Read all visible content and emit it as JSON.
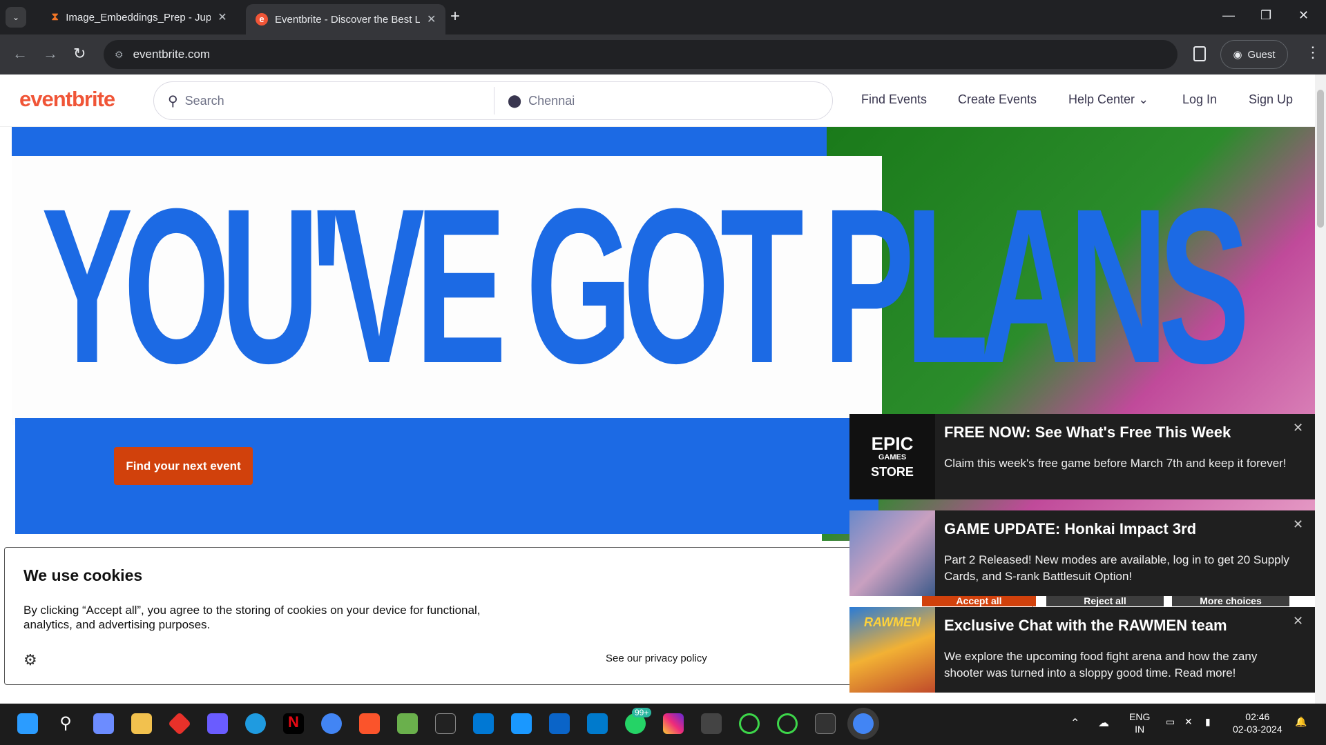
{
  "browser": {
    "tabs": [
      {
        "title": "Image_Embeddings_Prep - Jupy",
        "icon": "hourglass-icon",
        "active": false
      },
      {
        "title": "Eventbrite - Discover the Best L",
        "icon": "eventbrite-icon",
        "active": true
      }
    ],
    "url": "eventbrite.com",
    "profile_label": "Guest"
  },
  "site": {
    "logo": "eventbrite",
    "search_placeholder": "Search",
    "location": "Chennai",
    "nav": {
      "find_events": "Find Events",
      "create_events": "Create Events",
      "help_center": "Help Center",
      "log_in": "Log In",
      "sign_up": "Sign Up"
    },
    "hero": {
      "headline": "YOU'VE GOT PLANS",
      "cta": "Find your next event"
    },
    "cookies": {
      "title": "We use cookies",
      "text": "By clicking “Accept all”, you agree to the storing of cookies on your device for functional, analytics, and advertising purposes.",
      "privacy": "See our privacy policy",
      "accept": "Accept all",
      "reject": "Reject all",
      "more": "More choices"
    }
  },
  "notifications": [
    {
      "title": "FREE NOW: See What's Free This Week",
      "body": "Claim this week's free game before March 7th and keep it forever!",
      "thumb_lines": [
        "EPIC",
        "GAMES",
        "STORE"
      ]
    },
    {
      "title": "GAME UPDATE: Honkai Impact 3rd",
      "body": "Part 2 Released! New modes are available, log in to get 20 Supply Cards, and S-rank Battlesuit Option!"
    },
    {
      "title": "Exclusive Chat with the RAWMEN team",
      "body": "We explore the upcoming food fight arena and how the zany shooter was turned into a sloppy good time. Read more!",
      "thumb_label": "RAWMEN"
    }
  ],
  "taskbar": {
    "whatsapp_badge": "99+",
    "lang": "ENG",
    "region": "IN",
    "time": "02:46",
    "date": "02-03-2024"
  },
  "colors": {
    "brand_orange": "#f05537",
    "cta": "#d1410c",
    "hero_blue": "#1c6ae4"
  }
}
